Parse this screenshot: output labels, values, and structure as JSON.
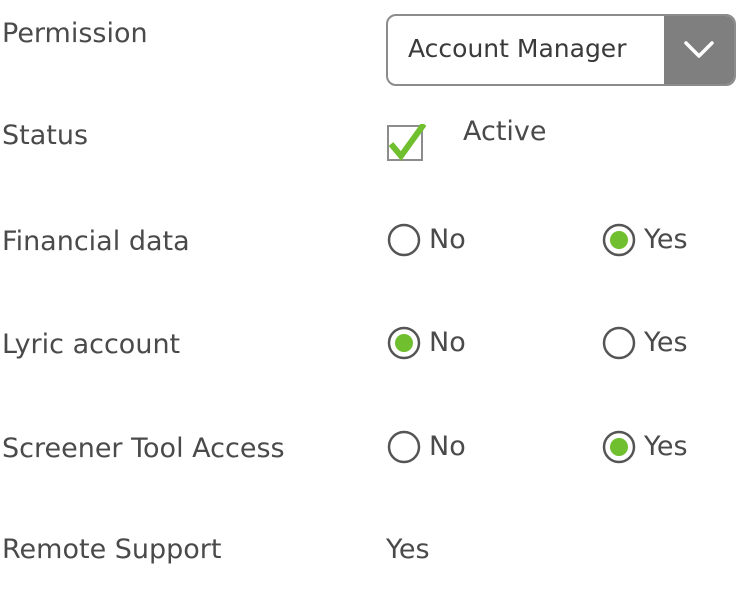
{
  "colors": {
    "accent_green": "#6fbf2e",
    "select_arrow_bg": "#7f7f7f",
    "border_gray": "#8c8c8c",
    "text": "#4a4a4a"
  },
  "fields": {
    "permission": {
      "label": "Permission",
      "value": "Account Manager",
      "icon": "chevron-down-icon"
    },
    "status": {
      "label": "Status",
      "checked": true,
      "option_label": "Active"
    },
    "financial_data": {
      "label": "Financial data",
      "options": [
        "No",
        "Yes"
      ],
      "selected": "Yes"
    },
    "lyric_account": {
      "label": "Lyric account",
      "options": [
        "No",
        "Yes"
      ],
      "selected": "No"
    },
    "screener_tool_access": {
      "label": "Screener Tool Access",
      "options": [
        "No",
        "Yes"
      ],
      "selected": "Yes"
    },
    "remote_support": {
      "label": "Remote Support",
      "value": "Yes"
    }
  }
}
